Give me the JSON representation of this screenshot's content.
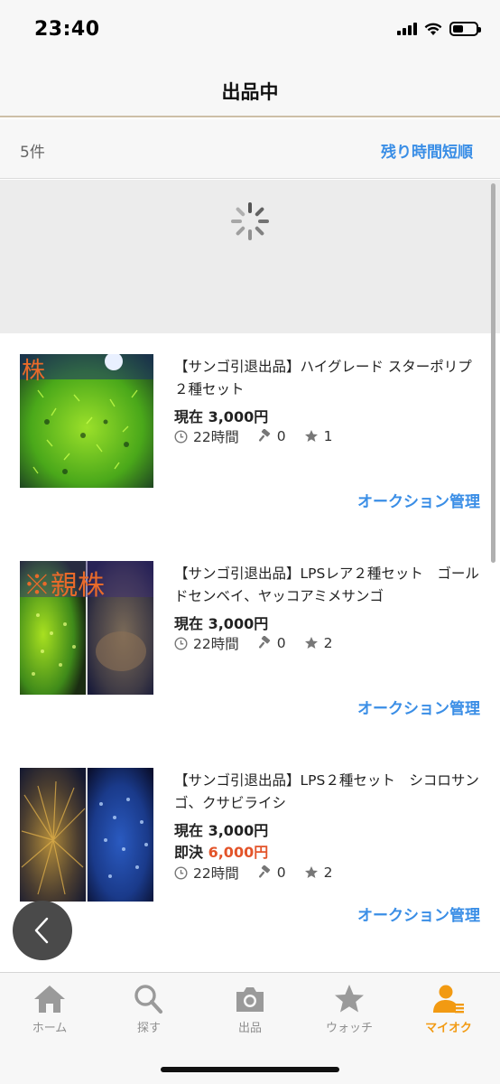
{
  "status_bar": {
    "time": "23:40"
  },
  "nav": {
    "title": "出品中"
  },
  "list_header": {
    "count": "5件",
    "sort_label": "残り時間短順"
  },
  "items": [
    {
      "title": "【サンゴ引退出品】ハイグレード スターポリプ　２種セット",
      "current_price_label": "現在",
      "current_price": "3,000円",
      "time_left": "22時間",
      "bids": "0",
      "watch": "1",
      "thumb_overlay_text": "株",
      "manage_label": "オークション管理"
    },
    {
      "title": "【サンゴ引退出品】LPSレア２種セット　ゴールドセンベイ、ヤッコアミメサンゴ",
      "current_price_label": "現在",
      "current_price": "3,000円",
      "time_left": "22時間",
      "bids": "0",
      "watch": "2",
      "thumb_overlay_text": "※親株",
      "manage_label": "オークション管理"
    },
    {
      "title": "【サンゴ引退出品】LPS２種セット　シコロサンゴ、クサビライシ",
      "current_price_label": "現在",
      "current_price": "3,000円",
      "buy_now_label": "即決",
      "buy_now_price": "6,000円",
      "time_left": "22時間",
      "bids": "0",
      "watch": "2",
      "manage_label": "オークション管理"
    }
  ],
  "tabs": [
    {
      "label": "ホーム",
      "icon": "home-icon"
    },
    {
      "label": "探す",
      "icon": "search-icon"
    },
    {
      "label": "出品",
      "icon": "camera-icon"
    },
    {
      "label": "ウォッチ",
      "icon": "star-icon"
    },
    {
      "label": "マイオク",
      "icon": "user-icon",
      "active": true
    }
  ],
  "colors": {
    "accent_blue": "#3a8ee6",
    "accent_orange": "#f29a12",
    "price_orange": "#e3542a",
    "header_divider": "#cdbfa7"
  }
}
